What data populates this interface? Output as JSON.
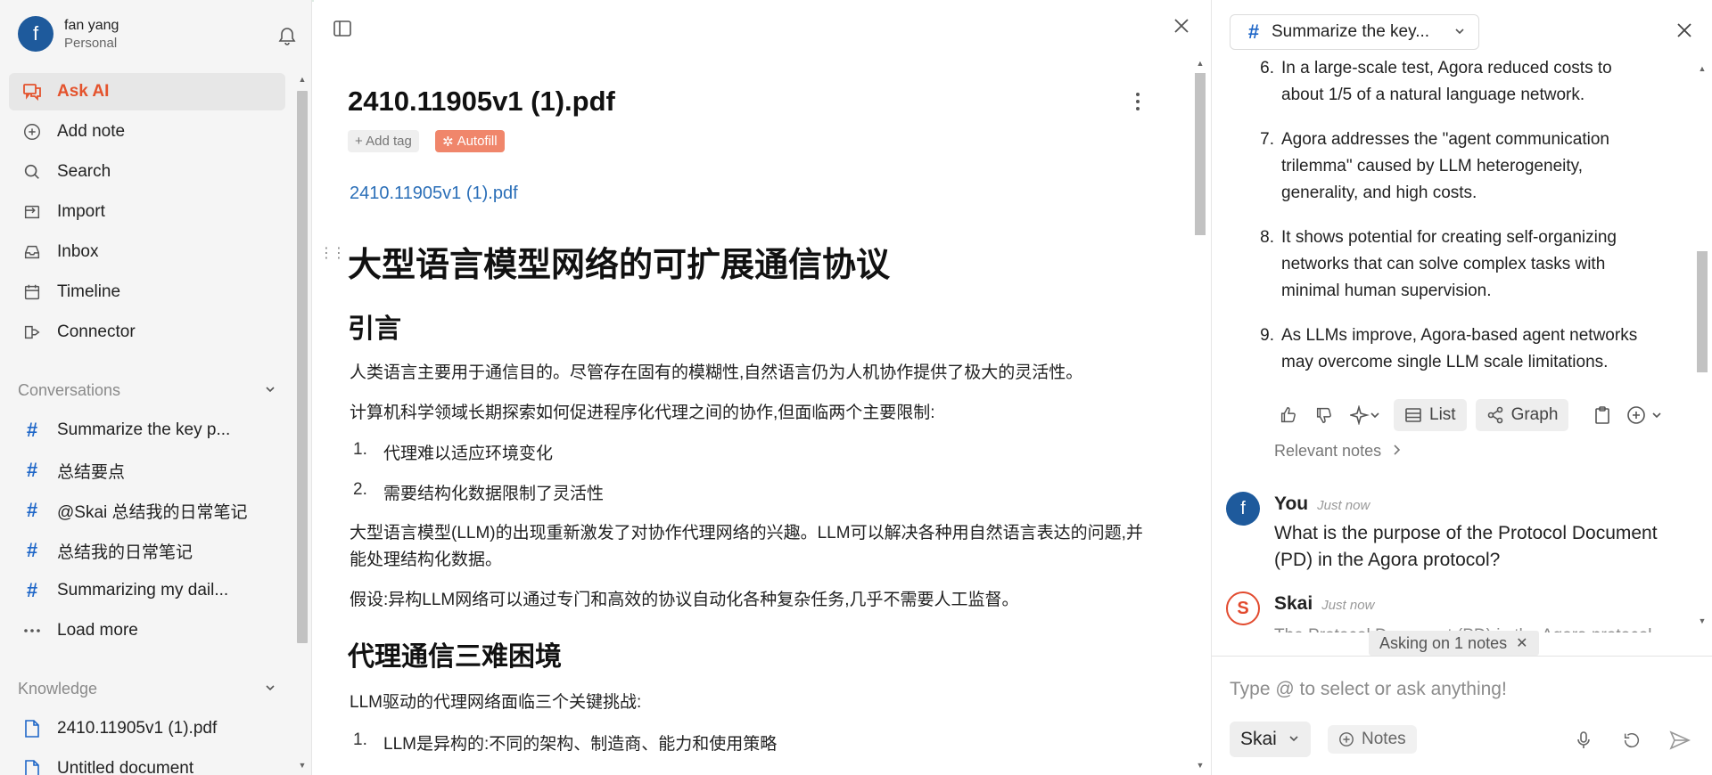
{
  "profile": {
    "avatar_letter": "f",
    "name": "fan yang",
    "workspace": "Personal"
  },
  "nav": [
    {
      "label": "Ask AI",
      "icon": "chat-bubbles-icon",
      "active": true
    },
    {
      "label": "Add note",
      "icon": "plus-circle-icon"
    },
    {
      "label": "Search",
      "icon": "search-icon"
    },
    {
      "label": "Import",
      "icon": "import-icon"
    },
    {
      "label": "Inbox",
      "icon": "inbox-icon"
    },
    {
      "label": "Timeline",
      "icon": "calendar-icon"
    },
    {
      "label": "Connector",
      "icon": "connector-icon"
    }
  ],
  "conversations": {
    "title": "Conversations",
    "items": [
      "Summarize the key p...",
      "总结要点",
      "@Skai 总结我的日常笔记",
      "总结我的日常笔记",
      "Summarizing my dail..."
    ],
    "load_more": "Load more"
  },
  "knowledge": {
    "title": "Knowledge",
    "items": [
      "2410.11905v1 (1).pdf",
      "Untitled document"
    ]
  },
  "doc": {
    "title": "2410.11905v1 (1).pdf",
    "add_tag": "+ Add tag",
    "autofill": "Autofill",
    "link": "2410.11905v1 (1).pdf",
    "h1": "大型语言模型网络的可扩展通信协议",
    "intro_heading": "引言",
    "p1": "人类语言主要用于通信目的。尽管存在固有的模糊性,自然语言仍为人机协作提供了极大的灵活性。",
    "p2": "计算机科学领域长期探索如何促进程序化代理之间的协作,但面临两个主要限制:",
    "list1": [
      "代理难以适应环境变化",
      "需要结构化数据限制了灵活性"
    ],
    "p3": "大型语言模型(LLM)的出现重新激发了对协作代理网络的兴趣。LLM可以解决各种用自然语言表达的问题,并能处理结构化数据。",
    "p4": "假设:异构LLM网络可以通过专门和高效的协议自动化各种复杂任务,几乎不需要人工监督。",
    "heading2": "代理通信三难困境",
    "p5": "LLM驱动的代理网络面临三个关键挑战:",
    "list2": [
      "LLM是异构的:不同的架构、制造商、能力和使用策略"
    ]
  },
  "chat": {
    "conversation_title": "Summarize the key...",
    "answer_items": [
      {
        "num": "6.",
        "text": "In a large-scale test, Agora reduced costs to about 1/5 of a natural language network."
      },
      {
        "num": "7.",
        "text": "Agora addresses the \"agent communication trilemma\" caused by LLM heterogeneity, generality, and high costs."
      },
      {
        "num": "8.",
        "text": "It shows potential for creating self-organizing networks that can solve complex tasks with minimal human supervision."
      },
      {
        "num": "9.",
        "text": "As LLMs improve, Agora-based agent networks may overcome single LLM scale limitations."
      }
    ],
    "list_label": "List",
    "graph_label": "Graph",
    "relevant_notes": "Relevant notes",
    "you": {
      "avatar_letter": "f",
      "name": "You",
      "time": "Just now",
      "text": "What is the purpose of the Protocol Document (PD) in the Agora protocol?"
    },
    "skai": {
      "avatar_letter": "S",
      "name": "Skai",
      "time": "Just now",
      "partial_text": "The Protocol Document (PD) in the Agora protocol"
    },
    "asking": "Asking on 1 notes",
    "input_placeholder": "Type @ to select or ask anything!",
    "model": "Skai",
    "notes_label": "Notes"
  },
  "colors": {
    "accent": "#e4532d",
    "brand_blue": "#1e5a9c",
    "link": "#2b6fb8",
    "hash": "#1f67c8"
  }
}
